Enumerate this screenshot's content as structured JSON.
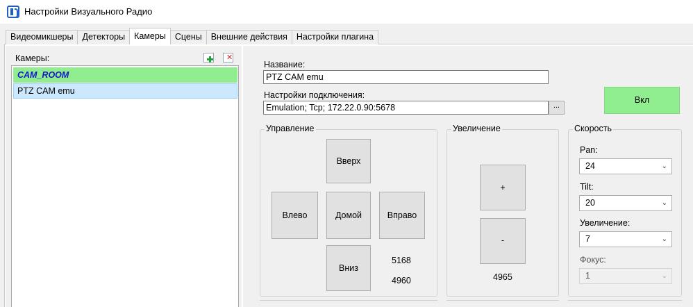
{
  "window": {
    "title": "Настройки Визуального Радио"
  },
  "tabs": [
    "Видеомикшеры",
    "Детекторы",
    "Камеры",
    "Сцены",
    "Внешние действия",
    "Настройки плагина"
  ],
  "active_tab": "Камеры",
  "cameras": {
    "label": "Камеры:",
    "items": [
      "CAM_ROOM",
      "PTZ CAM emu"
    ],
    "selected": "CAM_ROOM",
    "add_icon": "add-icon",
    "delete_icon": "delete-icon"
  },
  "details": {
    "name_label": "Название:",
    "name_value": "PTZ CAM emu",
    "connection_label": "Настройки подключения:",
    "connection_value": "Emulation; Tcp; 172.22.0.90:5678",
    "browse_label": "...",
    "on_button": "Вкл"
  },
  "control": {
    "title": "Управление",
    "up": "Вверх",
    "left": "Влево",
    "home": "Домой",
    "right": "Вправо",
    "down": "Вниз",
    "value1": "5168",
    "value2": "4960"
  },
  "zoom": {
    "title": "Увеличение",
    "plus": "+",
    "minus": "-",
    "value": "4965"
  },
  "speed": {
    "title": "Скорость",
    "pan_label": "Pan:",
    "pan_value": "24",
    "tilt_label": "Tilt:",
    "tilt_value": "20",
    "zoom_label": "Увеличение:",
    "zoom_value": "7",
    "focus_label": "Фокус:",
    "focus_value": "1"
  },
  "colors": {
    "selected_row": "#90ee90",
    "selected_text": "#1515c8",
    "highlight_row": "#cce8ff",
    "on_button": "#90ee90"
  }
}
